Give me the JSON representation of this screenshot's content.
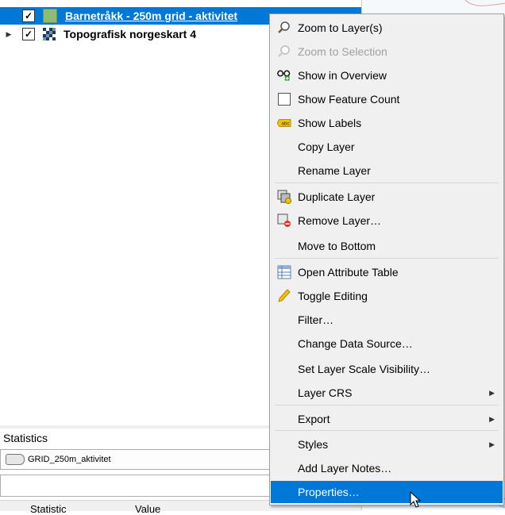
{
  "layers": [
    {
      "name": "Barnetråkk - 250m grid - aktivitet",
      "checked_mark": "✓",
      "selected": true,
      "swatch_color": "#8fbc73"
    },
    {
      "name": "Topografisk norgeskart 4",
      "checked_mark": "✓",
      "selected": false,
      "expander": "▶"
    }
  ],
  "statistics": {
    "title": "Statistics",
    "layer_combo_value": "GRID_250m_aktivitet",
    "columns": [
      "Statistic",
      "Value"
    ]
  },
  "context_menu": {
    "items": [
      {
        "label": "Zoom to Layer(s)",
        "icon": "zoom-icon"
      },
      {
        "label": "Zoom to Selection",
        "icon": "zoom-icon",
        "disabled": true
      },
      {
        "label": "Show in Overview",
        "icon": "overview-glasses-icon"
      },
      {
        "label": "Show Feature Count",
        "icon": "checkbox-icon"
      },
      {
        "label": "Show Labels",
        "icon": "labels-icon"
      },
      {
        "label": "Copy Layer"
      },
      {
        "label": "Rename Layer"
      },
      {
        "label": "Duplicate Layer",
        "icon": "duplicate-layer-icon"
      },
      {
        "label": "Remove Layer…",
        "icon": "remove-layer-icon"
      },
      {
        "label": "Move to Bottom"
      },
      {
        "label": "Open Attribute Table",
        "icon": "attribute-table-icon"
      },
      {
        "label": "Toggle Editing",
        "icon": "pencil-icon"
      },
      {
        "label": "Filter…"
      },
      {
        "label": "Change Data Source…"
      },
      {
        "label": "Set Layer Scale Visibility…"
      },
      {
        "label": "Layer CRS",
        "submenu": true
      },
      {
        "label": "Export",
        "submenu": true
      },
      {
        "label": "Styles",
        "submenu": true
      },
      {
        "label": "Add Layer Notes…"
      },
      {
        "label": "Properties…",
        "highlighted": true
      }
    ],
    "labels_icon_text": "abc",
    "submenu_arrow": "▶"
  },
  "colors": {
    "selection": "#0078d7",
    "menu_background": "#f0f0f0"
  }
}
